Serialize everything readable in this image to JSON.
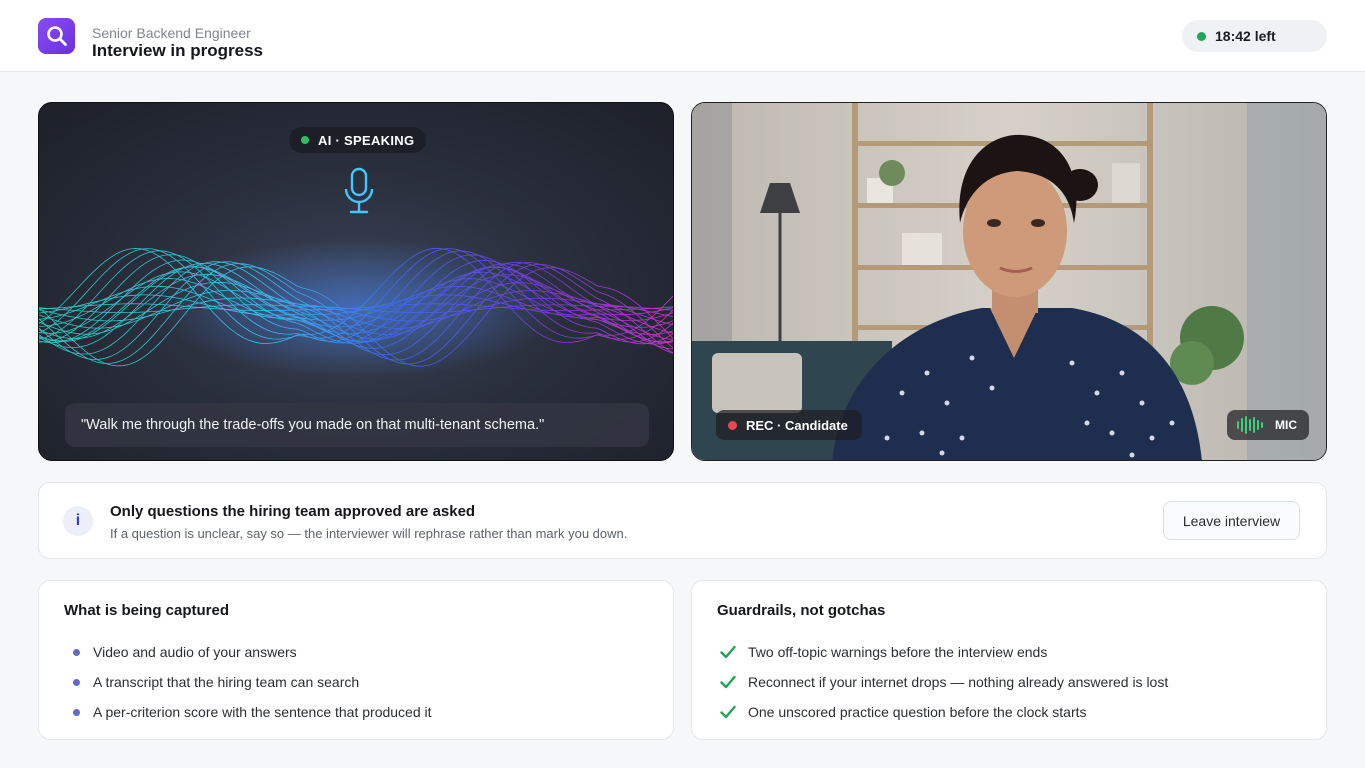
{
  "header": {
    "subtitle": "Senior Backend Engineer",
    "title": "Interview in progress",
    "timer": "18:42 left",
    "logo_icon": "search-icon"
  },
  "ai_panel": {
    "status": "AI · SPEAKING",
    "quote": "\"Walk me through the trade-offs you made on that multi-tenant schema.\"",
    "icon": "microphone-icon"
  },
  "camera_panel": {
    "rec_label": "REC · Candidate",
    "mic_label": "MIC"
  },
  "notice": {
    "icon": "info-icon",
    "title": "Only questions the hiring team approved are asked",
    "subtitle": "If a question is unclear, say so — the interviewer will rephrase rather than mark you down.",
    "button": "Leave interview"
  },
  "captured": {
    "title": "What is being captured",
    "items": [
      "Video and audio of your answers",
      "A transcript that the hiring team can search",
      "A per-criterion score with the sentence that produced it"
    ]
  },
  "guardrails": {
    "title": "Guardrails, not gotchas",
    "items": [
      "Two off-topic warnings before the interview ends",
      "Reconnect if your internet drops — nothing already answered is lost",
      "One unscored practice question before the clock starts"
    ]
  },
  "colors": {
    "accent": "#6a2fe0",
    "status_green": "#1fa85a",
    "rec_red": "#e5484d"
  }
}
